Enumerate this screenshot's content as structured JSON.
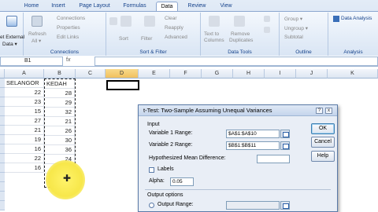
{
  "ribbon": {
    "tabs": [
      "Home",
      "Insert",
      "Page Layout",
      "Formulas",
      "Data",
      "Review",
      "View"
    ],
    "active_tab": "Data",
    "groups": {
      "get_external": {
        "label1": "et External",
        "label2": "Data ▾"
      },
      "connections": {
        "refresh_label": "Refresh",
        "refresh_sub": "All ▾",
        "items": [
          "Connections",
          "Properties",
          "Edit Links"
        ],
        "group_label": "Connections"
      },
      "sort_filter": {
        "sort": "Sort",
        "filter": "Filter",
        "items": [
          "Clear",
          "Reapply",
          "Advanced"
        ],
        "group_label": "Sort & Filter"
      },
      "data_tools": {
        "text_to_columns": [
          "Text to",
          "Columns"
        ],
        "remove_duplicates": [
          "Remove",
          "Duplicates"
        ],
        "group_label": "Data Tools"
      },
      "outline": {
        "items": [
          "Group ▾",
          "Ungroup ▾",
          "Subtotal"
        ],
        "group_label": "Outline"
      },
      "analysis": {
        "item": "Data Analysis",
        "group_label": "Analysis"
      }
    }
  },
  "formula_bar": {
    "name_box": "B1"
  },
  "sheet": {
    "columns": [
      "A",
      "B",
      "C",
      "D",
      "E",
      "F",
      "G",
      "H",
      "I",
      "J",
      "K"
    ],
    "selected_column": "D",
    "col_a": [
      "SELANGOR",
      "22",
      "23",
      "15",
      "27",
      "21",
      "19",
      "16",
      "22",
      "16"
    ],
    "col_b": [
      "KEDAH",
      "28",
      "29",
      "32",
      "21",
      "26",
      "30",
      "36",
      "24",
      "18"
    ]
  },
  "dialog": {
    "title": "t-Test: Two-Sample Assuming Unequal Variances",
    "help": "?",
    "close": "x",
    "input_section": "Input",
    "var1_label": "Variable 1 Range:",
    "var1_value": "$A$1:$A$10",
    "var2_label": "Variable 2 Range:",
    "var2_value": "$B$1:$B$11",
    "hyp_label": "Hypothesized Mean Difference:",
    "hyp_value": "",
    "labels_label": "Labels",
    "alpha_label": "Alpha:",
    "alpha_value": "0.05",
    "output_section": "Output options",
    "output_range_label": "Output Range:",
    "ok": "OK",
    "cancel": "Cancel",
    "help_button": "Help"
  }
}
